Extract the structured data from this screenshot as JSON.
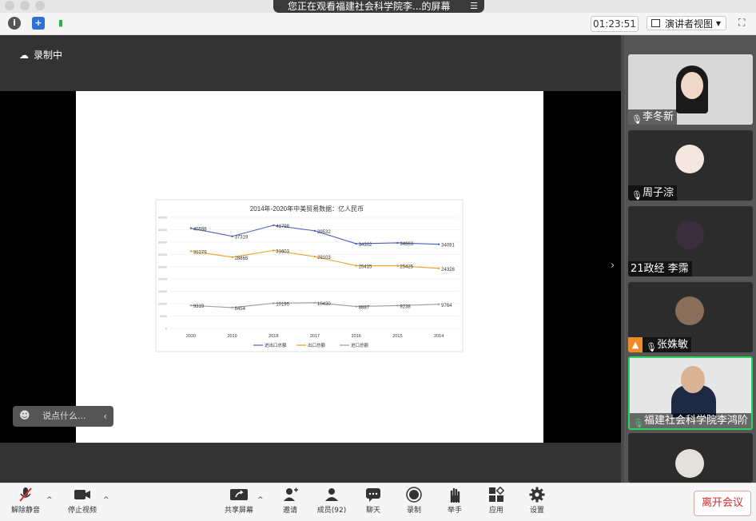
{
  "window": {
    "title": "您正在观看福建社会科学院李...的屏幕"
  },
  "toolbar": {
    "timer": "01:23:51",
    "view_label": "演讲者视图"
  },
  "recording_label": "录制中",
  "chat_placeholder": "说点什么...",
  "chart_data": {
    "type": "line",
    "title": "2014年-2020年中美贸易数据：亿人民币",
    "categories": [
      "2020",
      "2019",
      "2018",
      "2017",
      "2016",
      "2015",
      "2014"
    ],
    "ylim": [
      0,
      45000
    ],
    "y_ticks": [
      "45000",
      "40000",
      "35000",
      "30000",
      "25000",
      "20000",
      "15000",
      "10000",
      "5000",
      "0"
    ],
    "series": [
      {
        "name": "进出口总额",
        "color": "#4a5fc1",
        "values": [
          40598,
          37319,
          41798,
          39532,
          34302,
          34663,
          34091
        ]
      },
      {
        "name": "出口总额",
        "color": "#f0a020",
        "values": [
          31279,
          28865,
          31603,
          29103,
          25415,
          25425,
          24328
        ]
      },
      {
        "name": "进口总额",
        "color": "#9a9a9a",
        "values": [
          9319,
          8454,
          10195,
          10430,
          8887,
          9238,
          9764
        ]
      }
    ],
    "legend": "bottom"
  },
  "participants": [
    {
      "name": "李冬新"
    },
    {
      "name": "周子淙"
    },
    {
      "name": "21政经 李霈"
    },
    {
      "name": "张姝敏"
    },
    {
      "name": "福建社会科学院李鸿阶"
    },
    {
      "name": ""
    }
  ],
  "bottom": {
    "unmute": "解除静音",
    "stop_video": "停止视频",
    "share": "共享屏幕",
    "invite": "邀请",
    "members": "成员(92)",
    "chat": "聊天",
    "record": "录制",
    "raise_hand": "举手",
    "apps": "应用",
    "settings": "设置",
    "leave": "离开会议"
  }
}
